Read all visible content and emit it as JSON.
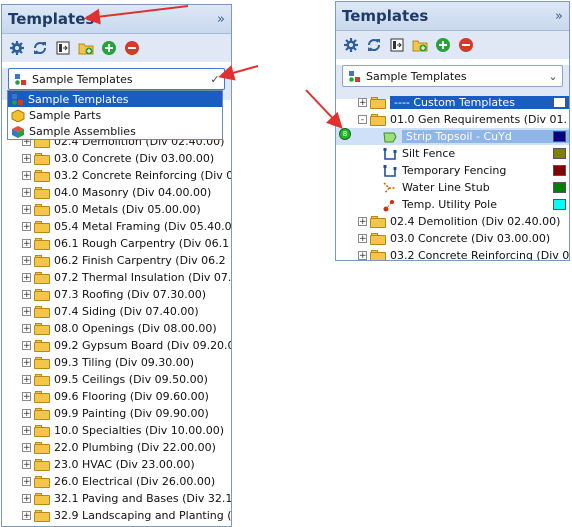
{
  "left_panel": {
    "title": "Templates",
    "collapse_glyph": "»",
    "toolbar": [
      "gear-icon",
      "refresh-icon",
      "import-icon",
      "folder-add-icon",
      "add-icon",
      "remove-icon"
    ],
    "combo": {
      "selected": "Sample Templates"
    },
    "dropdown": {
      "options": [
        {
          "label": "Sample Templates",
          "icon": "template-icon",
          "selected": true
        },
        {
          "label": "Sample Parts",
          "icon": "part-icon",
          "selected": false
        },
        {
          "label": "Sample Assemblies",
          "icon": "assembly-icon",
          "selected": false
        }
      ]
    },
    "tree": [
      "02.4  Demolition (Div 02.40.00)",
      "03.0  Concrete (Div 03.00.00)",
      "03.2  Concrete Reinforcing (Div 0",
      "04.0  Masonry (Div 04.00.00)",
      "05.0  Metals (Div 05.00.00)",
      "05.4  Metal Framing (Div 05.40.0",
      "06.1  Rough Carpentry (Div 06.1",
      "06.2  Finish Carpentry (Div 06.2",
      "07.2  Thermal Insulation (Div 07.",
      "07.3  Roofing (Div 07.30.00)",
      "07.4  Siding (Div 07.40.00)",
      "08.0  Openings (Div 08.00.00)",
      "09.2  Gypsum Board (Div 09.20.0",
      "09.3  Tiling (Div 09.30.00)",
      "09.5  Ceilings (Div 09.50.00)",
      "09.6  Flooring (Div 09.60.00)",
      "09.9  Painting (Div 09.90.00)",
      "10.0  Specialties (Div 10.00.00)",
      "22.0  Plumbing (Div 22.00.00)",
      "23.0  HVAC (Div 23.00.00)",
      "26.0  Electrical (Div 26.00.00)",
      "32.1  Paving and Bases (Div 32.1",
      "32.9  Landscaping and Planting ("
    ]
  },
  "right_panel": {
    "title": "Templates",
    "collapse_glyph": "»",
    "combo": {
      "selected": "Sample Templates"
    },
    "marker_label": "8",
    "tree": [
      {
        "label": "----  Custom Templates",
        "type": "folder",
        "level": 0,
        "exp": "+",
        "highlight": "blue",
        "swatch": "#ffffff"
      },
      {
        "label": "01.0  Gen Requirements (Div 01.",
        "type": "folder",
        "level": 0,
        "exp": "-"
      },
      {
        "label": "Strip Topsoil - CuYd",
        "type": "area",
        "level": 1,
        "highlight": "selected",
        "swatch": "#000080"
      },
      {
        "label": "Silt Fence",
        "type": "line",
        "level": 1,
        "swatch": "#808000"
      },
      {
        "label": "Temporary Fencing",
        "type": "line",
        "level": 1,
        "swatch": "#800000"
      },
      {
        "label": "Water Line Stub",
        "type": "line2",
        "level": 1,
        "swatch": "#008000"
      },
      {
        "label": "Temp. Utility Pole",
        "type": "count",
        "level": 1,
        "swatch": "#00ffff"
      },
      {
        "label": "02.4  Demolition (Div 02.40.00)",
        "type": "folder",
        "level": 0,
        "exp": "+"
      },
      {
        "label": "03.0  Concrete (Div 03.00.00)",
        "type": "folder",
        "level": 0,
        "exp": "+"
      },
      {
        "label": "03.2  Concrete Reinforcing (Div 0",
        "type": "folder",
        "level": 0,
        "exp": "+"
      }
    ]
  },
  "colors": {
    "arrow": "#e03030",
    "selection": "#1a5dc0",
    "header_text": "#1f3a63"
  }
}
